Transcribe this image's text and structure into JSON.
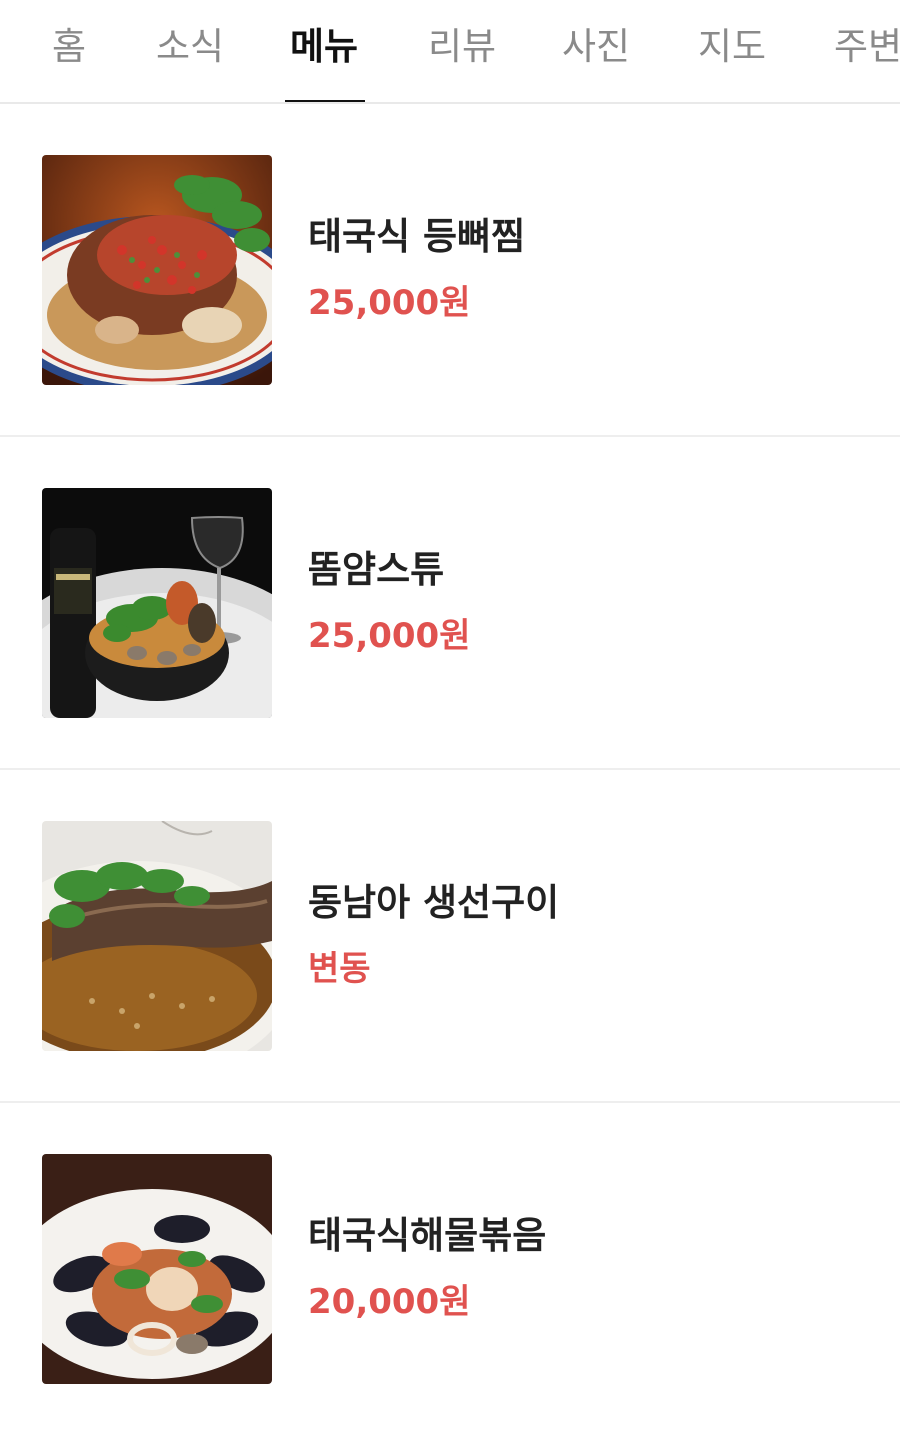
{
  "tabs": [
    {
      "label": "홈"
    },
    {
      "label": "소식"
    },
    {
      "label": "메뉴",
      "active": true
    },
    {
      "label": "리뷰"
    },
    {
      "label": "사진"
    },
    {
      "label": "지도"
    },
    {
      "label": "주변"
    }
  ],
  "menu": {
    "items": [
      {
        "name": "태국식 등뼈찜",
        "price": "25,000원"
      },
      {
        "name": "똠얌스튜",
        "price": "25,000원"
      },
      {
        "name": "동남아 생선구이",
        "price": "변동"
      },
      {
        "name": "태국식해물볶음",
        "price": "20,000원"
      }
    ]
  },
  "colors": {
    "price": "#e0524f",
    "active_tab": "#111111",
    "inactive_tab": "#8a8a8a"
  }
}
